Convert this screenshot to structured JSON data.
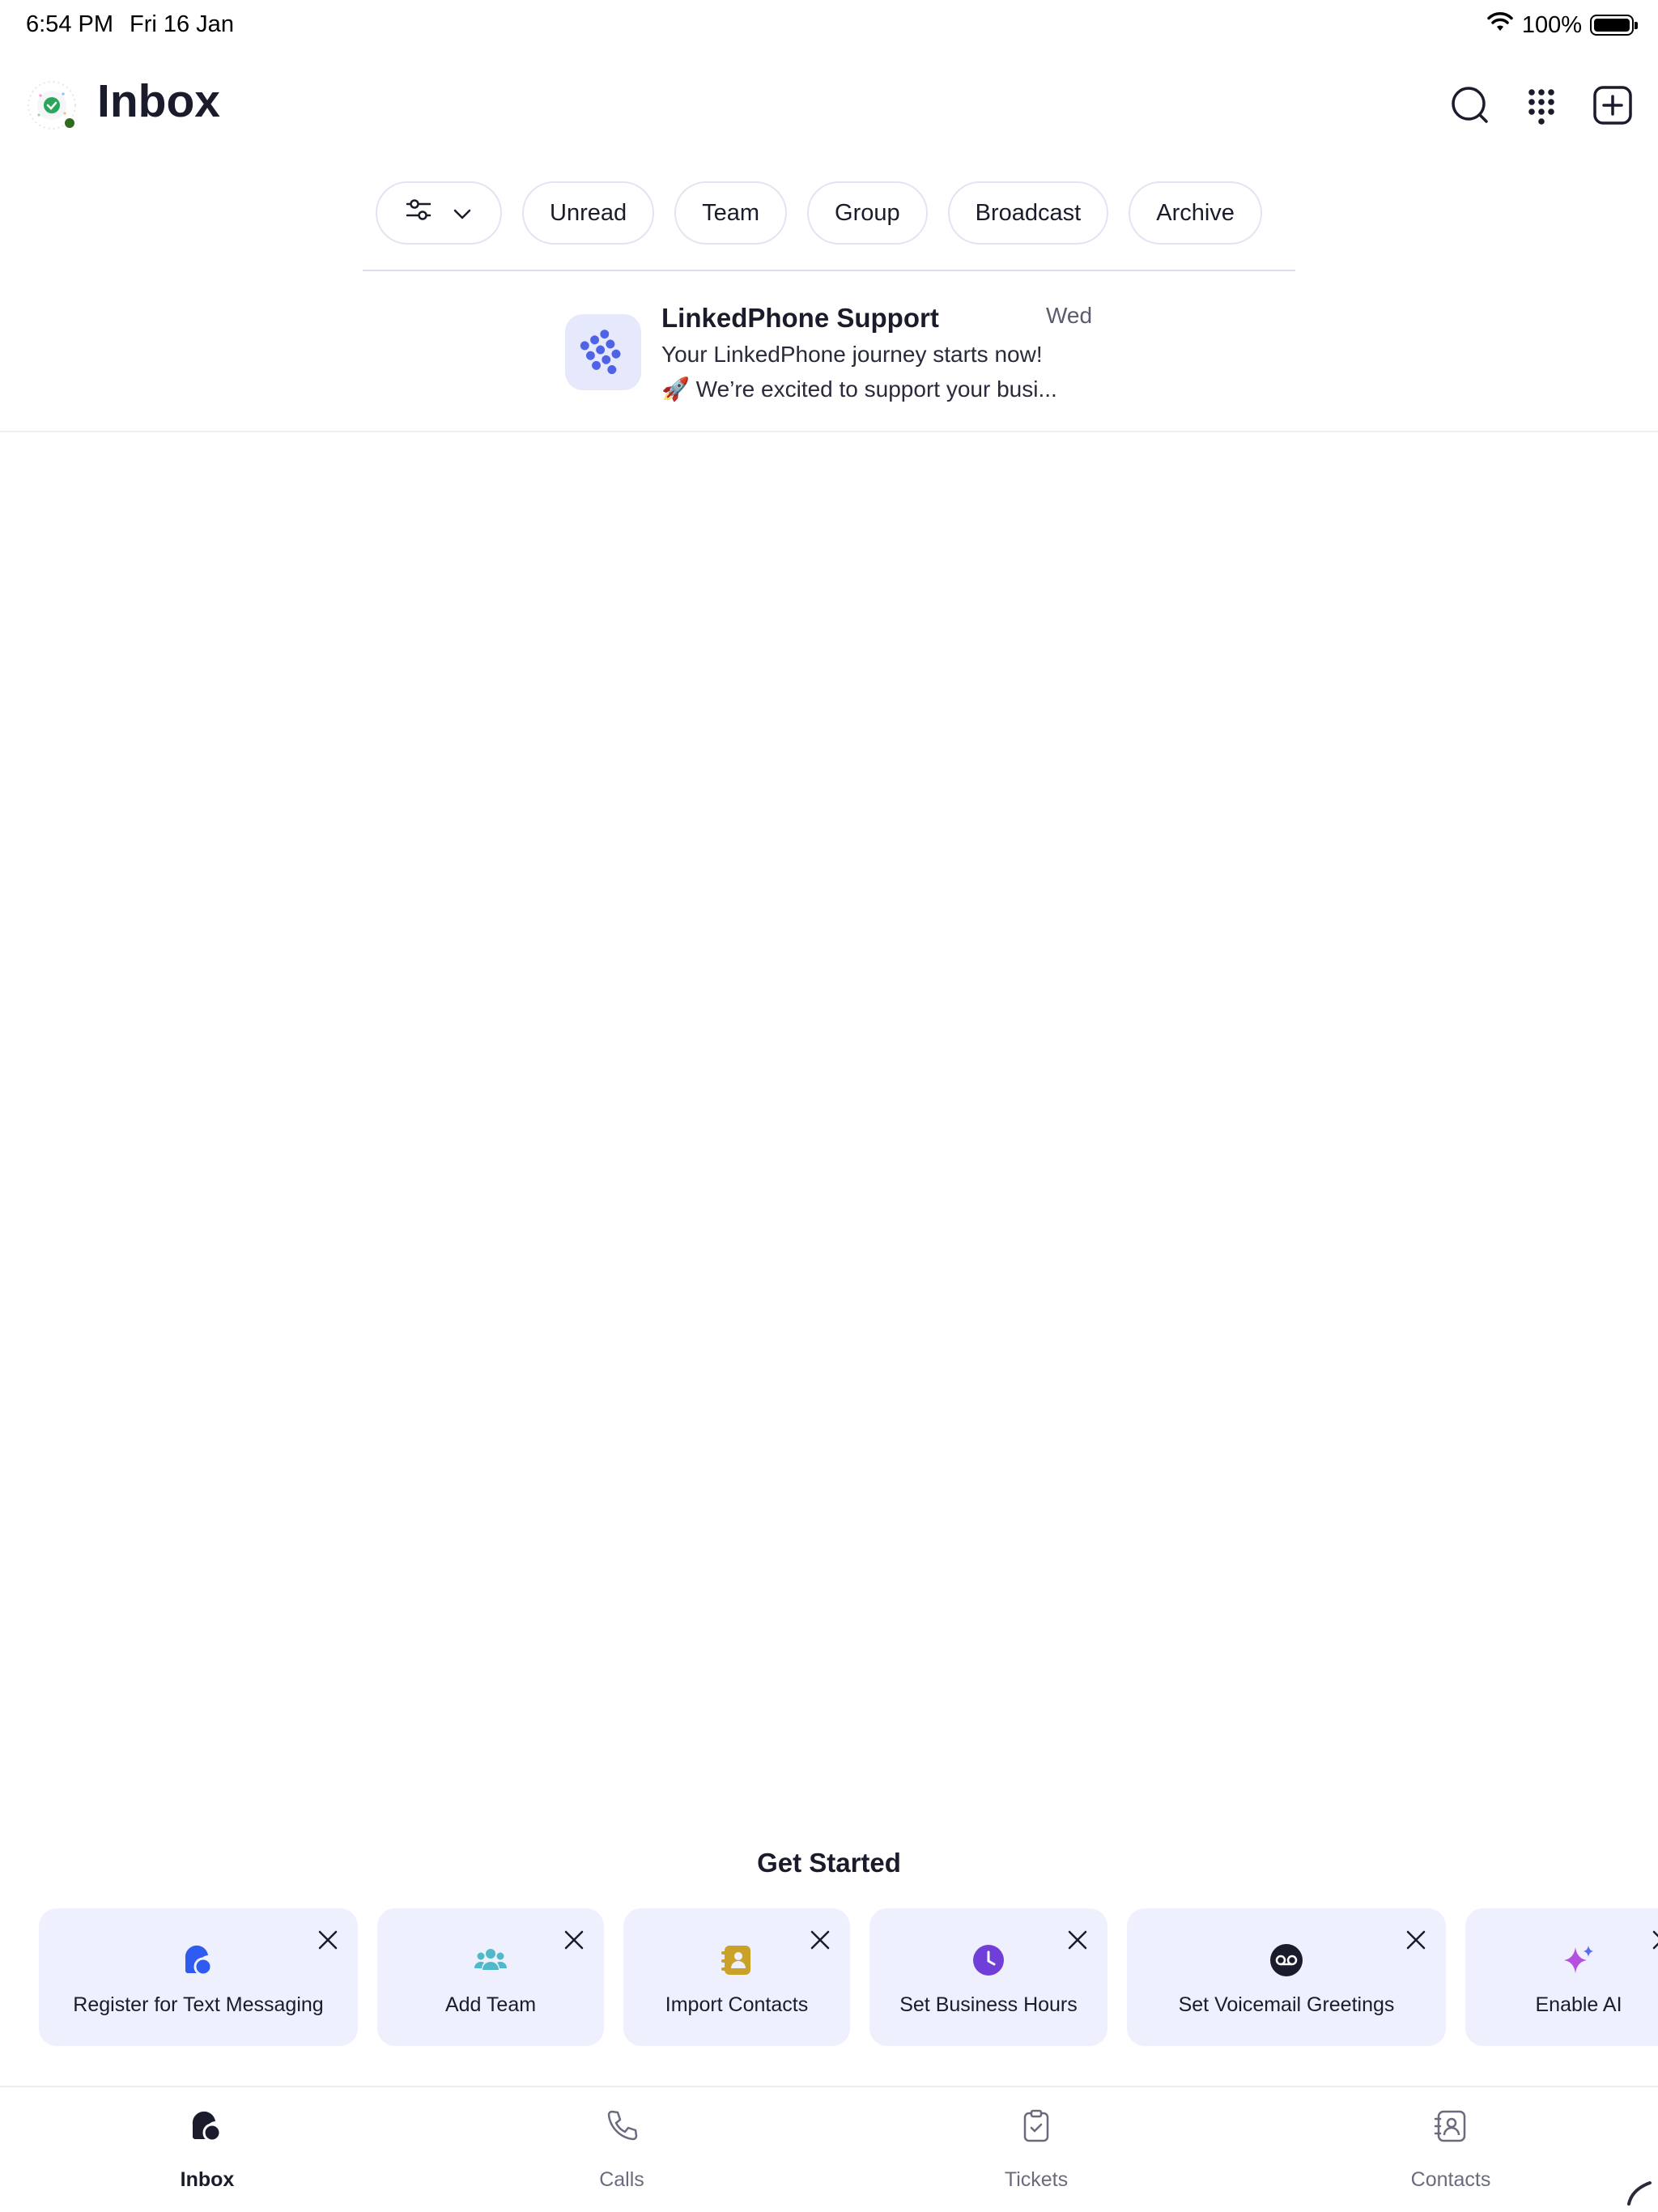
{
  "status_bar": {
    "time": "6:54 PM",
    "date": "Fri 16 Jan",
    "battery": "100%",
    "wifi_icon": "wifi-icon",
    "battery_icon": "battery-icon"
  },
  "header": {
    "title": "Inbox",
    "icons": [
      "search-icon",
      "dialpad-icon",
      "compose-icon"
    ]
  },
  "filters": {
    "filter_icon": "sliders-icon",
    "chips": [
      "Unread",
      "Team",
      "Group",
      "Broadcast",
      "Archive"
    ]
  },
  "conversations": [
    {
      "name": "LinkedPhone Support",
      "time": "Wed",
      "line1": "Your LinkedPhone journey starts now!",
      "line2": "🚀  We’re excited to support your busi...",
      "avatar_icon": "linkedphone-logo-icon"
    }
  ],
  "get_started": {
    "title": "Get Started",
    "cards": [
      {
        "label": "Register for Text Messaging",
        "icon": "messaging-icon",
        "color": "#2f5bf0"
      },
      {
        "label": "Add Team",
        "icon": "team-icon",
        "color": "#4fb8c9"
      },
      {
        "label": "Import Contacts",
        "icon": "contacts-book-icon",
        "color": "#c9a227"
      },
      {
        "label": "Set Business Hours",
        "icon": "clock-icon",
        "color": "#6f3fd8"
      },
      {
        "label": "Set Voicemail Greetings",
        "icon": "voicemail-icon",
        "color": "#1b1c2b"
      },
      {
        "label": "Enable AI",
        "icon": "sparkle-icon",
        "color": "#b44fe0"
      }
    ]
  },
  "tabs": [
    {
      "label": "Inbox",
      "icon": "inbox-icon",
      "active": true
    },
    {
      "label": "Calls",
      "icon": "phone-icon",
      "active": false
    },
    {
      "label": "Tickets",
      "icon": "ticket-clipboard-icon",
      "active": false
    },
    {
      "label": "Contacts",
      "icon": "contact-card-icon",
      "active": false
    }
  ]
}
